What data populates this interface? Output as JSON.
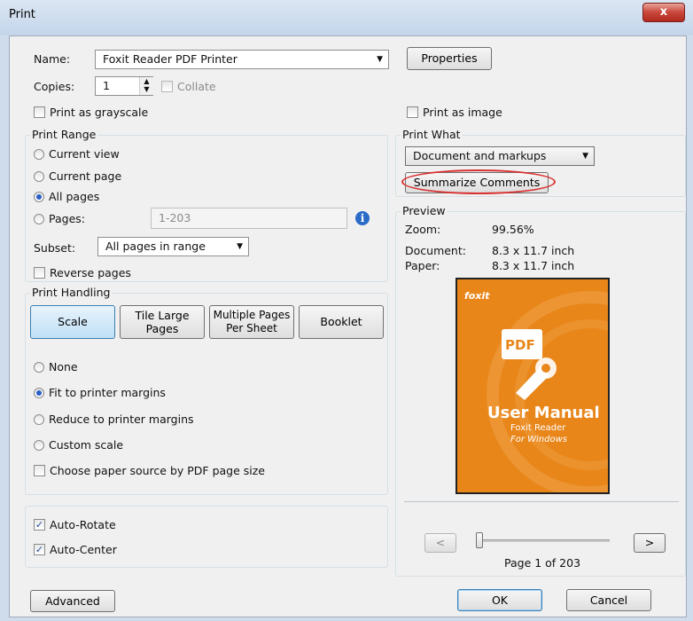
{
  "window": {
    "title": "Print",
    "close_glyph": "x"
  },
  "printer": {
    "name_label": "Name:",
    "name_value": "Foxit Reader PDF Printer",
    "properties_label": "Properties",
    "copies_label": "Copies:",
    "copies_value": "1",
    "collate_label": "Collate",
    "grayscale_label": "Print as grayscale",
    "image_label": "Print as image"
  },
  "print_range": {
    "title": "Print Range",
    "current_view": "Current view",
    "current_page": "Current page",
    "all_pages": "All pages",
    "pages_label": "Pages:",
    "pages_placeholder": "1-203",
    "subset_label": "Subset:",
    "subset_value": "All pages in range",
    "reverse_label": "Reverse pages"
  },
  "print_what": {
    "title": "Print What",
    "value": "Document and markups",
    "summarize_label": "Summarize Comments"
  },
  "preview": {
    "title": "Preview",
    "zoom_label": "Zoom:",
    "zoom_value": "99.56%",
    "document_label": "Document:",
    "document_value": "8.3 x 11.7 inch",
    "paper_label": "Paper:",
    "paper_value": "8.3 x 11.7 inch",
    "cover_brand": "foxit",
    "cover_pdf": "PDF",
    "cover_title": "User Manual",
    "cover_sub1": "Foxit Reader",
    "cover_sub2": "For Windows",
    "prev_glyph": "<",
    "next_glyph": ">",
    "page_text": "Page 1 of 203",
    "slider_level": 0.0
  },
  "handling": {
    "title": "Print Handling",
    "scale": "Scale",
    "tile_l1": "Tile Large",
    "tile_l2": "Pages",
    "multi_l1": "Multiple Pages",
    "multi_l2": "Per Sheet",
    "booklet": "Booklet",
    "none": "None",
    "fit": "Fit to printer margins",
    "reduce": "Reduce to printer margins",
    "custom": "Custom scale",
    "paper_source": "Choose paper source by PDF page size"
  },
  "auto": {
    "rotate": "Auto-Rotate",
    "center": "Auto-Center"
  },
  "footer": {
    "advanced": "Advanced",
    "ok": "OK",
    "cancel": "Cancel"
  }
}
